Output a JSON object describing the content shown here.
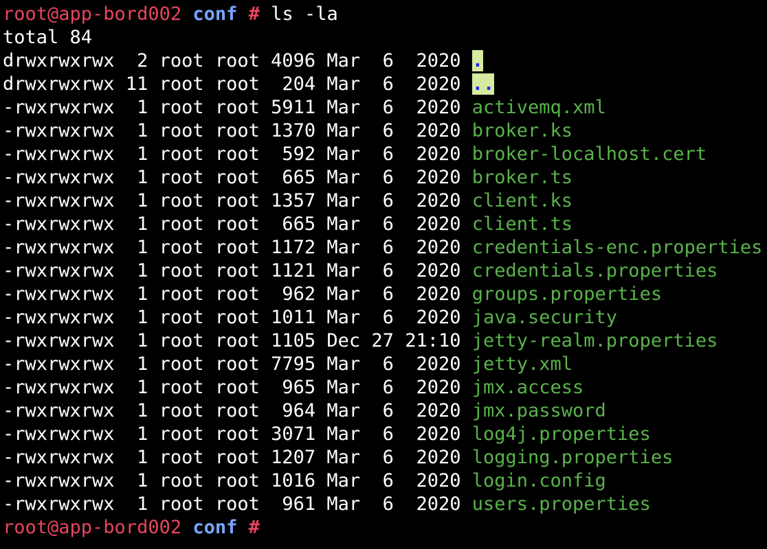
{
  "prompt": {
    "user_host": "root@app-bord002",
    "dir": "conf",
    "hash": "#"
  },
  "command": "ls -la",
  "total": "total 84",
  "rows": [
    {
      "perm": "drwxrwxrwx",
      "links": "2",
      "owner": "root",
      "group": "root",
      "size": "4096",
      "month": "Mar",
      "day": "6",
      "time": "2020",
      "name": ".",
      "kind": "dir"
    },
    {
      "perm": "drwxrwxrwx",
      "links": "11",
      "owner": "root",
      "group": "root",
      "size": "204",
      "month": "Mar",
      "day": "6",
      "time": "2020",
      "name": "..",
      "kind": "dir"
    },
    {
      "perm": "-rwxrwxrwx",
      "links": "1",
      "owner": "root",
      "group": "root",
      "size": "5911",
      "month": "Mar",
      "day": "6",
      "time": "2020",
      "name": "activemq.xml",
      "kind": "file"
    },
    {
      "perm": "-rwxrwxrwx",
      "links": "1",
      "owner": "root",
      "group": "root",
      "size": "1370",
      "month": "Mar",
      "day": "6",
      "time": "2020",
      "name": "broker.ks",
      "kind": "file"
    },
    {
      "perm": "-rwxrwxrwx",
      "links": "1",
      "owner": "root",
      "group": "root",
      "size": "592",
      "month": "Mar",
      "day": "6",
      "time": "2020",
      "name": "broker-localhost.cert",
      "kind": "file"
    },
    {
      "perm": "-rwxrwxrwx",
      "links": "1",
      "owner": "root",
      "group": "root",
      "size": "665",
      "month": "Mar",
      "day": "6",
      "time": "2020",
      "name": "broker.ts",
      "kind": "file"
    },
    {
      "perm": "-rwxrwxrwx",
      "links": "1",
      "owner": "root",
      "group": "root",
      "size": "1357",
      "month": "Mar",
      "day": "6",
      "time": "2020",
      "name": "client.ks",
      "kind": "file"
    },
    {
      "perm": "-rwxrwxrwx",
      "links": "1",
      "owner": "root",
      "group": "root",
      "size": "665",
      "month": "Mar",
      "day": "6",
      "time": "2020",
      "name": "client.ts",
      "kind": "file"
    },
    {
      "perm": "-rwxrwxrwx",
      "links": "1",
      "owner": "root",
      "group": "root",
      "size": "1172",
      "month": "Mar",
      "day": "6",
      "time": "2020",
      "name": "credentials-enc.properties",
      "kind": "file"
    },
    {
      "perm": "-rwxrwxrwx",
      "links": "1",
      "owner": "root",
      "group": "root",
      "size": "1121",
      "month": "Mar",
      "day": "6",
      "time": "2020",
      "name": "credentials.properties",
      "kind": "file"
    },
    {
      "perm": "-rwxrwxrwx",
      "links": "1",
      "owner": "root",
      "group": "root",
      "size": "962",
      "month": "Mar",
      "day": "6",
      "time": "2020",
      "name": "groups.properties",
      "kind": "file"
    },
    {
      "perm": "-rwxrwxrwx",
      "links": "1",
      "owner": "root",
      "group": "root",
      "size": "1011",
      "month": "Mar",
      "day": "6",
      "time": "2020",
      "name": "java.security",
      "kind": "file"
    },
    {
      "perm": "-rwxrwxrwx",
      "links": "1",
      "owner": "root",
      "group": "root",
      "size": "1105",
      "month": "Dec",
      "day": "27",
      "time": "21:10",
      "name": "jetty-realm.properties",
      "kind": "file"
    },
    {
      "perm": "-rwxrwxrwx",
      "links": "1",
      "owner": "root",
      "group": "root",
      "size": "7795",
      "month": "Mar",
      "day": "6",
      "time": "2020",
      "name": "jetty.xml",
      "kind": "file"
    },
    {
      "perm": "-rwxrwxrwx",
      "links": "1",
      "owner": "root",
      "group": "root",
      "size": "965",
      "month": "Mar",
      "day": "6",
      "time": "2020",
      "name": "jmx.access",
      "kind": "file"
    },
    {
      "perm": "-rwxrwxrwx",
      "links": "1",
      "owner": "root",
      "group": "root",
      "size": "964",
      "month": "Mar",
      "day": "6",
      "time": "2020",
      "name": "jmx.password",
      "kind": "file"
    },
    {
      "perm": "-rwxrwxrwx",
      "links": "1",
      "owner": "root",
      "group": "root",
      "size": "3071",
      "month": "Mar",
      "day": "6",
      "time": "2020",
      "name": "log4j.properties",
      "kind": "file"
    },
    {
      "perm": "-rwxrwxrwx",
      "links": "1",
      "owner": "root",
      "group": "root",
      "size": "1207",
      "month": "Mar",
      "day": "6",
      "time": "2020",
      "name": "logging.properties",
      "kind": "file"
    },
    {
      "perm": "-rwxrwxrwx",
      "links": "1",
      "owner": "root",
      "group": "root",
      "size": "1016",
      "month": "Mar",
      "day": "6",
      "time": "2020",
      "name": "login.config",
      "kind": "file"
    },
    {
      "perm": "-rwxrwxrwx",
      "links": "1",
      "owner": "root",
      "group": "root",
      "size": "961",
      "month": "Mar",
      "day": "6",
      "time": "2020",
      "name": "users.properties",
      "kind": "file"
    }
  ],
  "colors": {
    "background": "#000000",
    "text": "#ffffff",
    "prompt_user": "#e8455e",
    "prompt_dir": "#7aa6ff",
    "file_name": "#59b34a",
    "dir_name": "#2222ff",
    "dir_highlight": "#d6eaa0"
  }
}
